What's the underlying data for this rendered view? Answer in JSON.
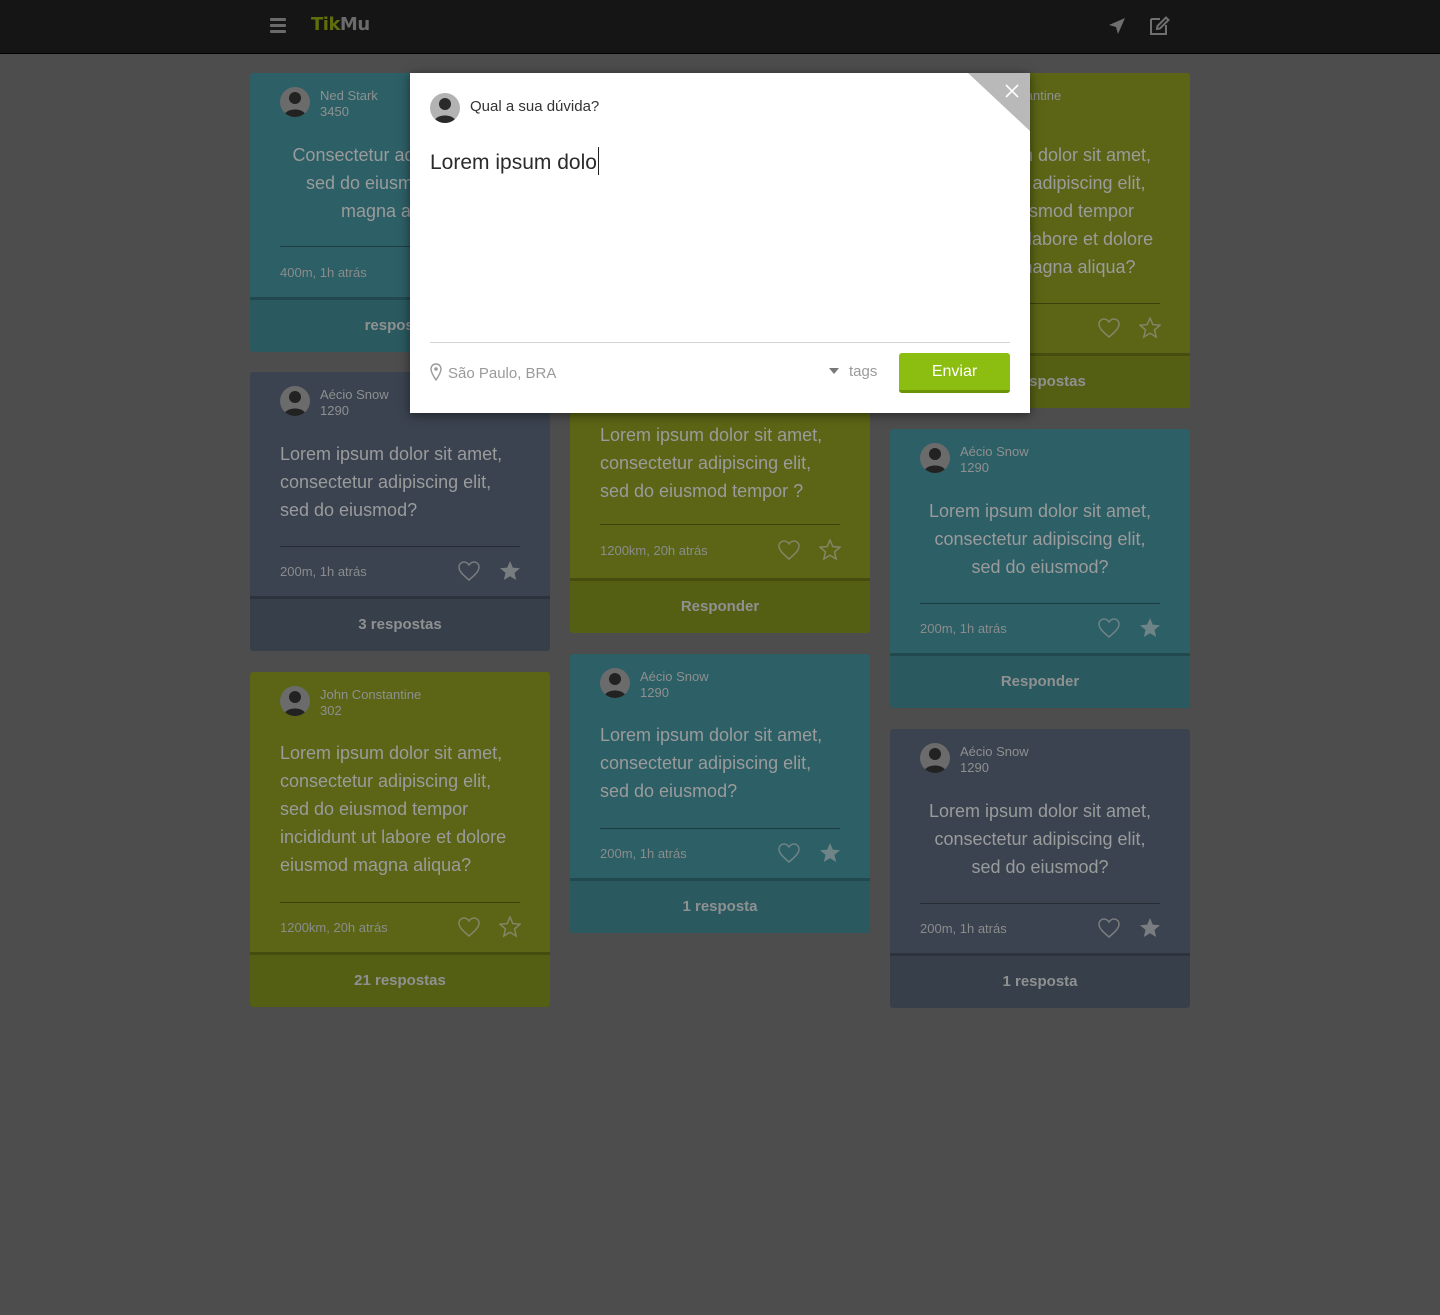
{
  "app": {
    "logo_part1": "Tik",
    "logo_part2": "Mu"
  },
  "columns": [
    [
      {
        "theme": "teal",
        "user": "Ned Stark",
        "count": "3450",
        "text": "Consectetur adipiscing elit, sed do eiusmod tempor magna aliqua?",
        "center": true,
        "meta": "400m, 1h atrás",
        "fav": "outline",
        "footer": "respostas"
      },
      {
        "theme": "slate",
        "user": "Aécio Snow",
        "count": "1290",
        "text": "Lorem ipsum dolor sit amet, consectetur adipiscing elit, sed do eiusmod?",
        "center": false,
        "meta": "200m, 1h atrás",
        "fav": "filled",
        "footer": "3 respostas"
      },
      {
        "theme": "olive",
        "user": "John Constantine",
        "count": "302",
        "text": "Lorem ipsum dolor sit amet, consectetur adipiscing elit, sed do eiusmod tempor incididunt ut labore et dolore eiusmod magna aliqua?",
        "center": false,
        "meta": "1200km, 20h atrás",
        "fav": "outline",
        "footer": "21 respostas"
      }
    ],
    [
      {
        "theme": "olive",
        "user": "",
        "count": "",
        "text": "Lorem ipsum dolor sit amet, consectetur adipiscing elit, sed do eiusmod tempor ?",
        "center": false,
        "meta": "1200km, 20h atrás",
        "fav": "outline",
        "footer": "Responder"
      },
      {
        "theme": "teal",
        "user": "Aécio Snow",
        "count": "1290",
        "text": "Lorem ipsum dolor sit amet, consectetur adipiscing elit, sed do eiusmod?",
        "center": false,
        "meta": "200m, 1h atrás",
        "fav": "filled",
        "footer": "1 resposta"
      }
    ],
    [
      {
        "theme": "olive",
        "user": "John Constantine",
        "count": "",
        "text": "Lorem ipsum dolor sit amet, consectetur adipiscing elit, sed do eiusmod tempor incididunt ut labore et dolore eiusmod magna aliqua?",
        "center": true,
        "meta": "",
        "fav": "outline",
        "footer": "21 respostas"
      },
      {
        "theme": "teal",
        "user": "Aécio Snow",
        "count": "1290",
        "text": "Lorem ipsum dolor sit amet, consectetur adipiscing elit, sed do eiusmod?",
        "center": true,
        "meta": "200m, 1h atrás",
        "fav": "filled",
        "footer": "Responder"
      },
      {
        "theme": "slate",
        "user": "Aécio Snow",
        "count": "1290",
        "text": "Lorem ipsum dolor sit amet, consectetur adipiscing elit, sed do eiusmod?",
        "center": true,
        "meta": "200m, 1h atrás",
        "fav": "filled",
        "footer": "1 resposta"
      }
    ]
  ],
  "modal": {
    "prompt": "Qual a sua dúvida?",
    "input_value": "Lorem ipsum dolo",
    "location": "São Paulo, BRA",
    "tags_label": "tags",
    "send_label": "Enviar"
  },
  "colors": {
    "teal": "#2d5f66",
    "slate": "#3b4350",
    "olive": "#5b6515",
    "accent": "#8cbd11"
  }
}
